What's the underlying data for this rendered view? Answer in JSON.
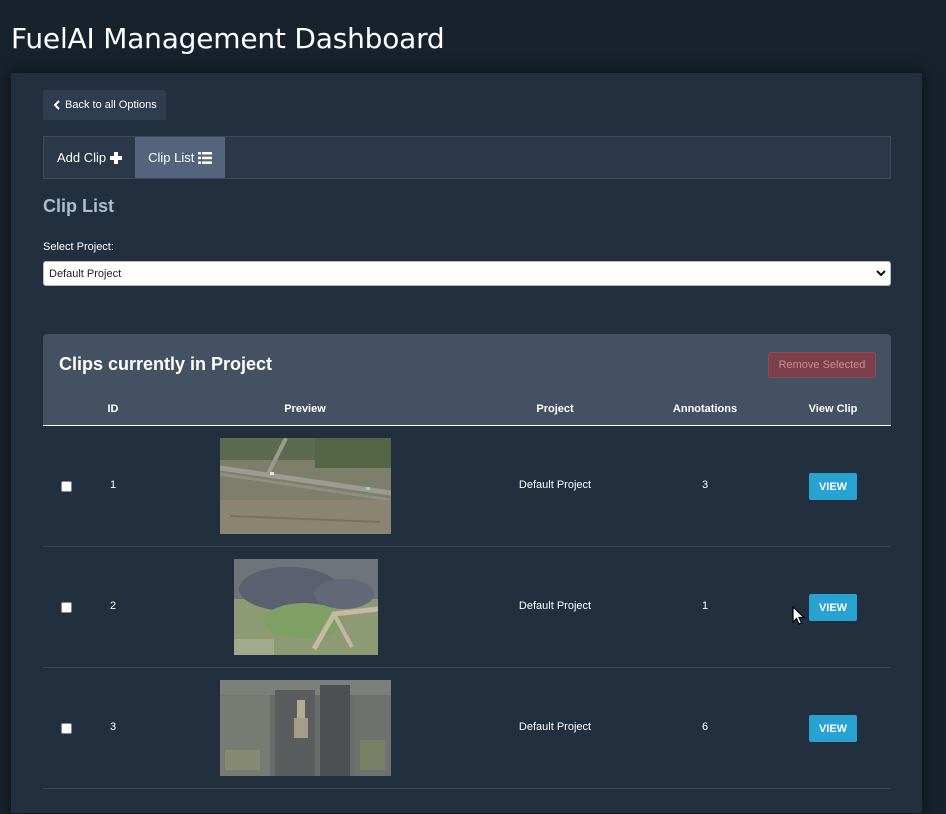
{
  "app": {
    "title": "FuelAI Management Dashboard"
  },
  "nav": {
    "back_label": "Back to all Options"
  },
  "tabs": [
    {
      "label": "Add Clip",
      "icon": "plus-icon",
      "active": false
    },
    {
      "label": "Clip List",
      "icon": "list-icon",
      "active": true
    }
  ],
  "section": {
    "title": "Clip List"
  },
  "project_select": {
    "label": "Select Project:",
    "value": "Default Project"
  },
  "clips": {
    "title": "Clips currently in Project",
    "remove_label": "Remove Selected",
    "columns": [
      "ID",
      "Preview",
      "Project",
      "Annotations",
      "View Clip"
    ],
    "rows": [
      {
        "id": "1",
        "project": "Default Project",
        "annotations": "3",
        "view_label": "VIEW",
        "preview": "aerial-road-field"
      },
      {
        "id": "2",
        "project": "Default Project",
        "annotations": "1",
        "view_label": "VIEW",
        "preview": "aerial-smoke-field"
      },
      {
        "id": "3",
        "project": "Default Project",
        "annotations": "6",
        "view_label": "VIEW",
        "preview": "aerial-city-block"
      }
    ]
  },
  "colors": {
    "background": "#17222c",
    "panel": "#212f3f",
    "accent_view": "#27a2d3",
    "remove_disabled": "#7d3f49",
    "section_title": "#a9bdd4"
  }
}
